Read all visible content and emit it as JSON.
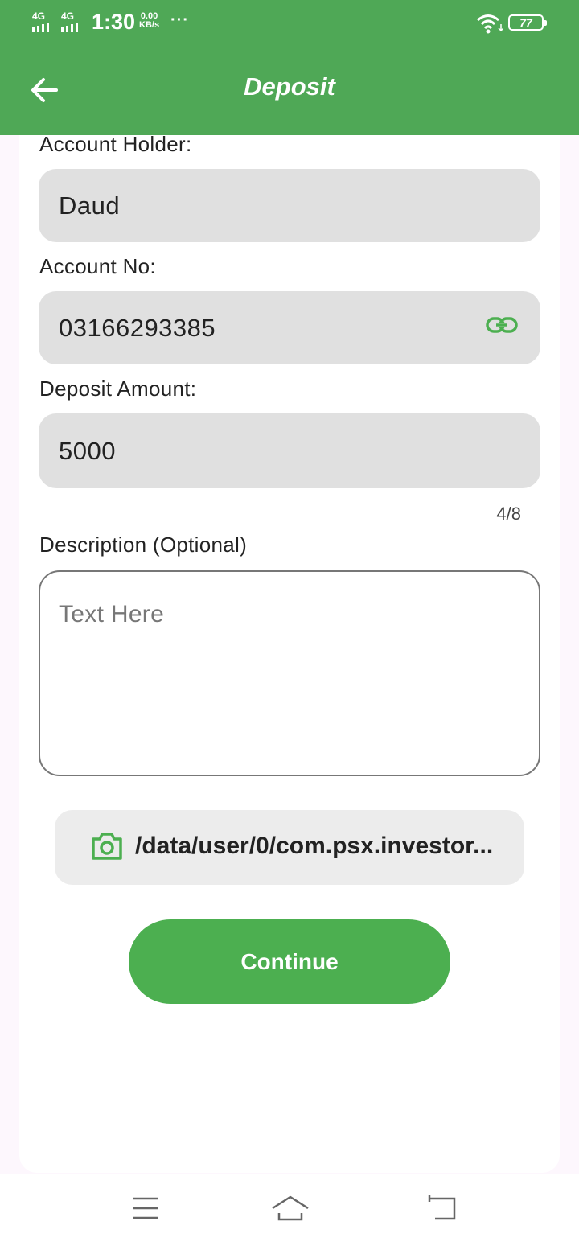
{
  "status_bar": {
    "signal1_label": "4G",
    "signal2_label": "4G",
    "time": "1:30",
    "speed_value": "0.00",
    "speed_unit": "KB/s",
    "more": "···",
    "battery": "77"
  },
  "header": {
    "title": "Deposit",
    "back_icon": "arrow-left-icon"
  },
  "form": {
    "account_holder_label": "Account Holder:",
    "account_holder_value": "Daud",
    "account_no_label": "Account No:",
    "account_no_value": "03166293385",
    "account_no_icon": "link-icon",
    "deposit_amount_label": "Deposit Amount:",
    "deposit_amount_value": "5000",
    "deposit_amount_counter": "4/8",
    "description_label": "Description (Optional)",
    "description_placeholder": "Text Here",
    "attachment_icon": "camera-icon",
    "attachment_path": "/data/user/0/com.psx.investor...",
    "continue_label": "Continue"
  },
  "colors": {
    "brand_green": "#4fa856",
    "button_green": "#4caf50",
    "field_gray": "#e0e0e0"
  },
  "nav": {
    "menu_icon": "menu-icon",
    "home_icon": "home-icon",
    "back_icon": "back-icon"
  }
}
